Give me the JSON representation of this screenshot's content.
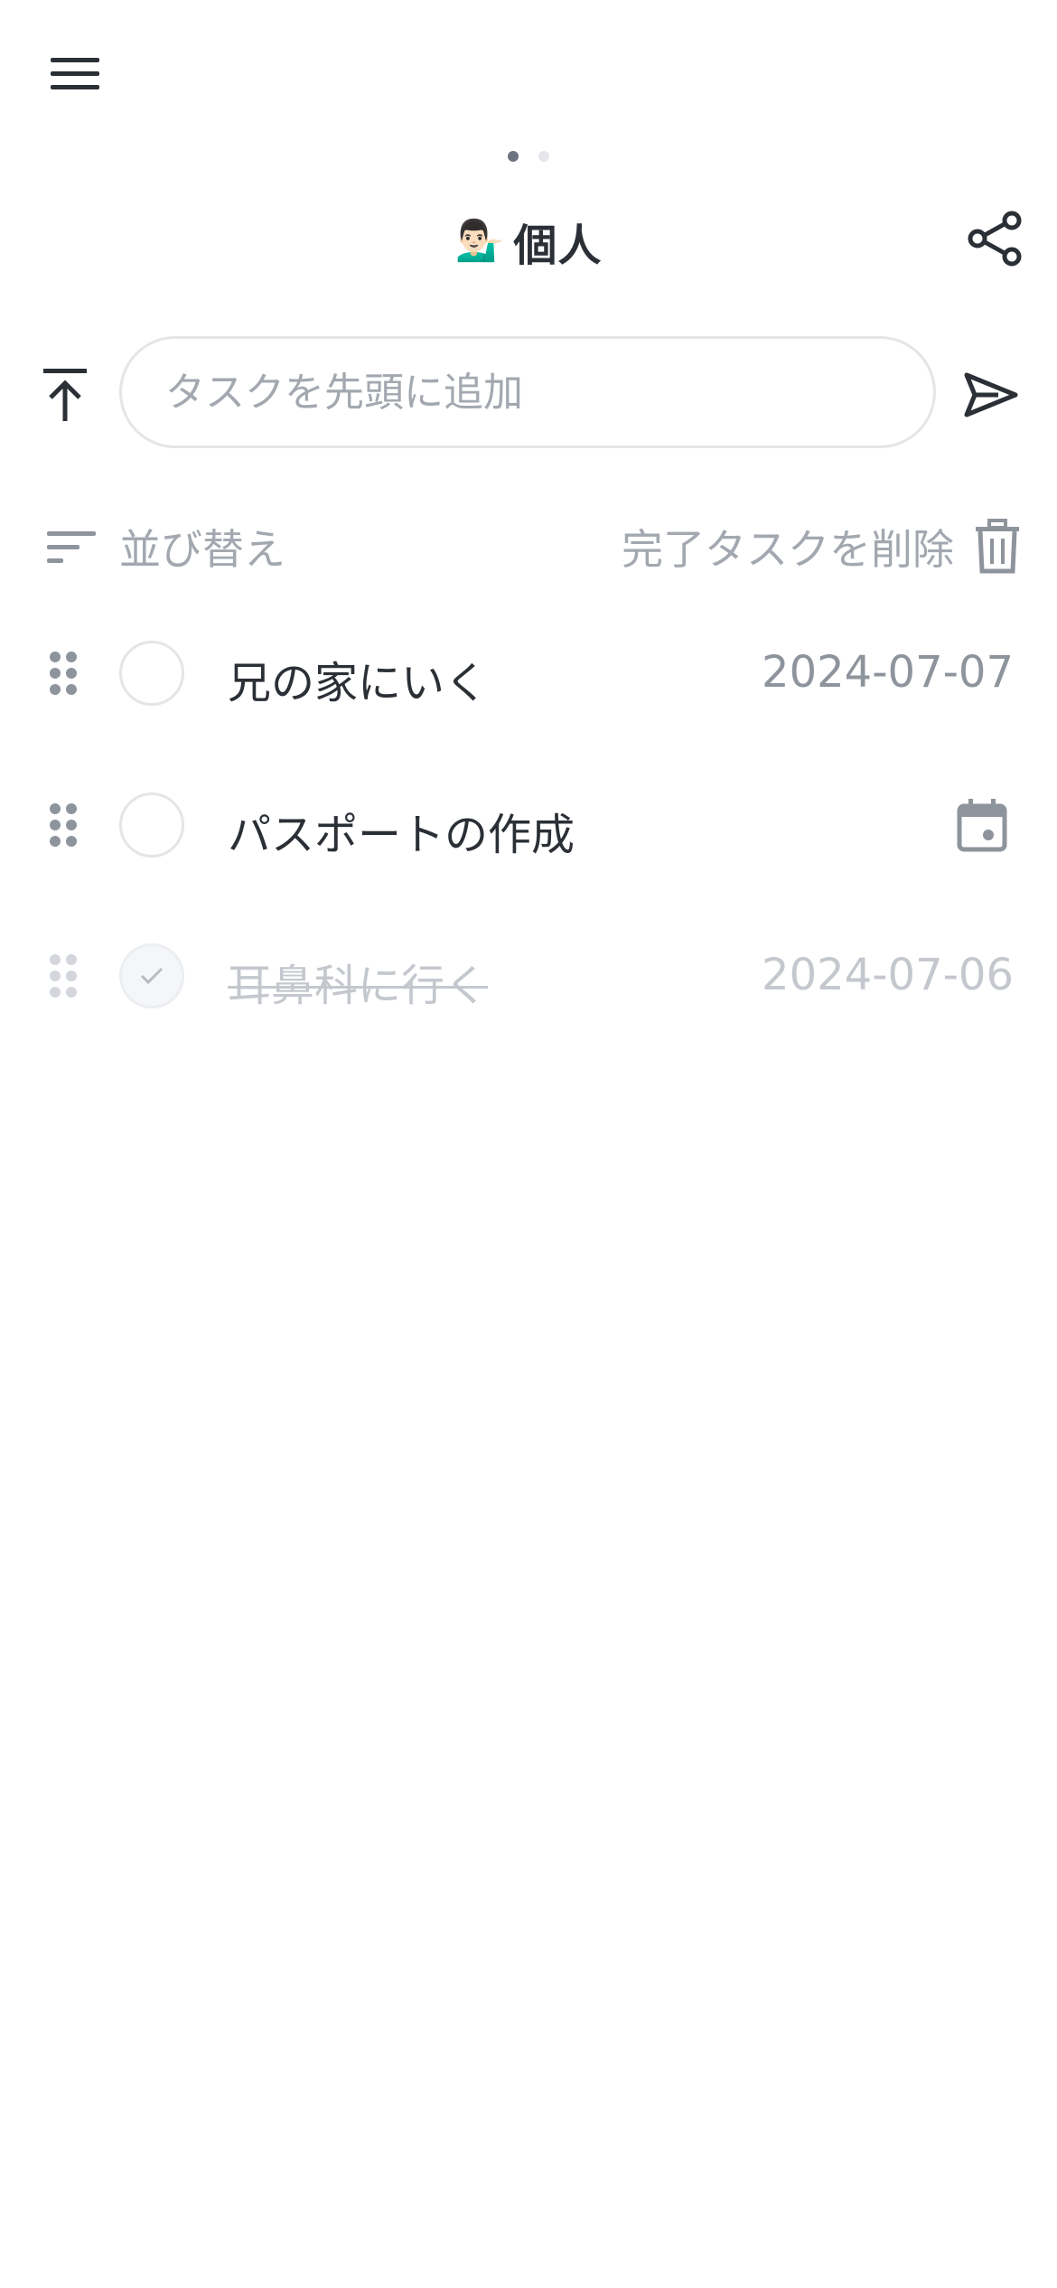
{
  "header": {
    "title_emoji": "💁🏻‍♂️",
    "title": "個人",
    "page_indicator": {
      "count": 2,
      "active_index": 0
    }
  },
  "add_task": {
    "placeholder": "タスクを先頭に追加",
    "value": ""
  },
  "actions": {
    "sort_label": "並び替え",
    "delete_completed_label": "完了タスクを削除"
  },
  "tasks": [
    {
      "title": "兄の家にいく",
      "date": "2024-07-07",
      "completed": false
    },
    {
      "title": "パスポートの作成",
      "date": "",
      "completed": false
    },
    {
      "title": "耳鼻科に行く",
      "date": "2024-07-06",
      "completed": true
    }
  ],
  "icons": {
    "menu": "hamburger-icon",
    "share": "share-icon",
    "add_to_top": "arrow-to-top-icon",
    "send": "send-icon",
    "sort": "sort-icon",
    "delete": "trash-icon",
    "drag": "drag-handle-icon",
    "check": "check-icon",
    "calendar": "calendar-icon"
  },
  "colors": {
    "text_primary": "#2b2f36",
    "text_muted": "#a3a8b0",
    "text_disabled": "#c4c8ce",
    "border": "#e3e5e8",
    "icon_muted": "#8e949c"
  }
}
